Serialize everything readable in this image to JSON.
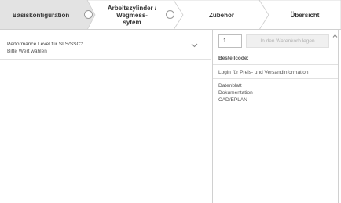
{
  "stepper": {
    "steps": [
      {
        "label": "Basiskonfiguration",
        "active": true
      },
      {
        "label": "Arbeitszylinder / Wegmess-\nsytem",
        "active": false
      },
      {
        "label": "Zubehör",
        "active": false
      },
      {
        "label": "Übersicht",
        "active": false
      }
    ],
    "colors": {
      "active": "#e3e3e3",
      "inactive": "#ffffff",
      "border": "#cfcfcf"
    }
  },
  "config": {
    "field_label": "Performance Level für SLS/SSC?",
    "field_value": "Bitte Wert wählen"
  },
  "cart": {
    "quantity": "1",
    "add_to_cart_label": "In den Warenkorb legen",
    "order_code_label": "Bestellcode:",
    "login_link": "Login für Preis- und Versandinformation",
    "documents": [
      "Datenblatt",
      "Dokumentation",
      "CAD/EPLAN"
    ]
  }
}
